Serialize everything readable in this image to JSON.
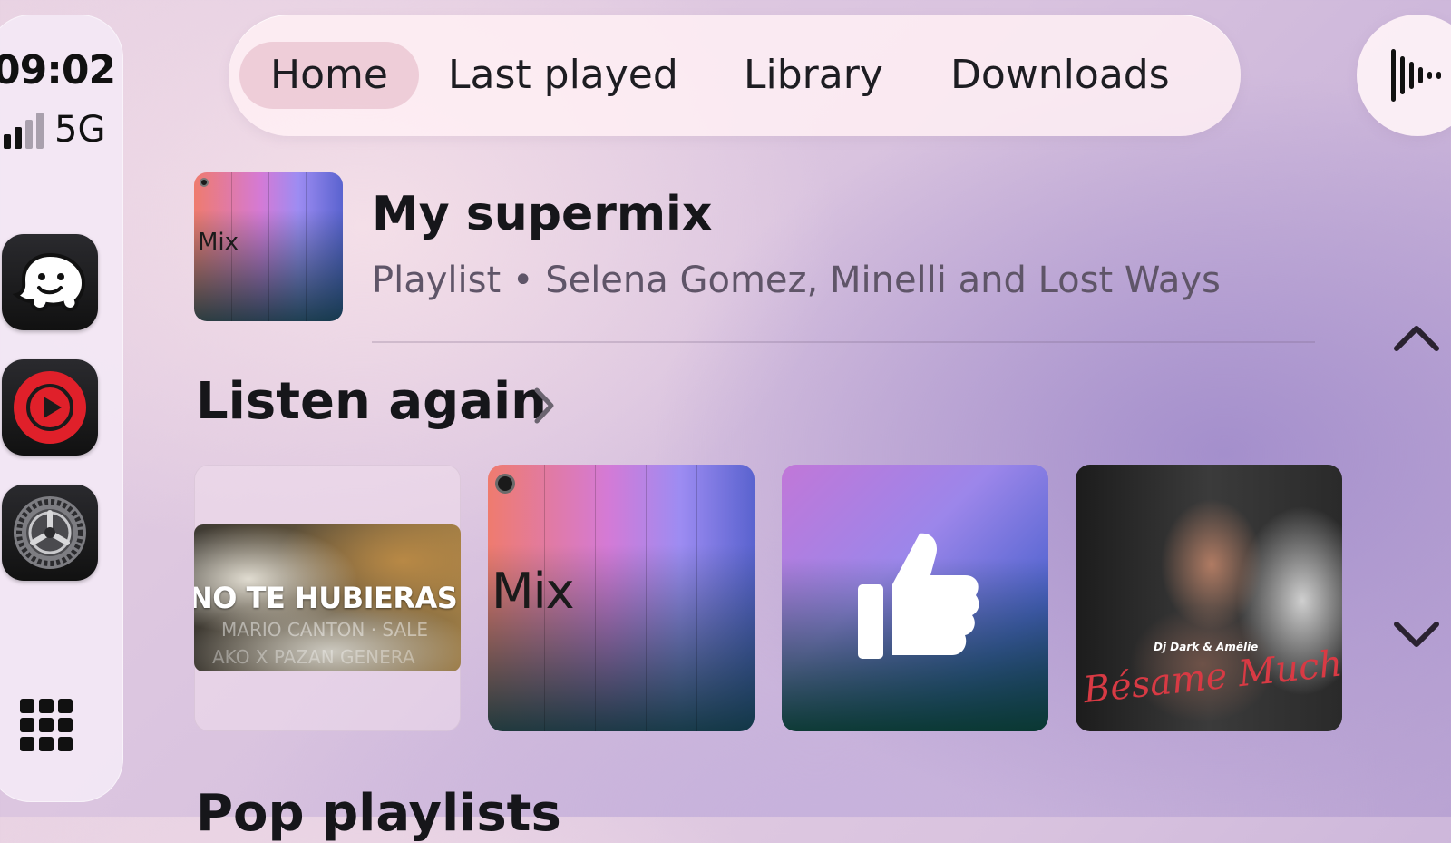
{
  "status": {
    "time": "09:02",
    "network": "5G",
    "signal_bars": 2
  },
  "dock": {
    "apps": [
      {
        "name": "Waze",
        "icon": "waze-icon"
      },
      {
        "name": "YouTube Music",
        "icon": "youtube-music-icon"
      },
      {
        "name": "Settings",
        "icon": "gear-icon"
      }
    ],
    "app_grid_icon": "app-grid-icon"
  },
  "tabs": [
    {
      "label": "Home",
      "active": true
    },
    {
      "label": "Last played",
      "active": false
    },
    {
      "label": "Library",
      "active": false
    },
    {
      "label": "Downloads",
      "active": false
    }
  ],
  "voice_icon": "voice-waveform-icon",
  "featured": {
    "thumb_label": "Mix",
    "title": "My supermix",
    "subtitle": "Playlist • Selena Gomez, Minelli and Lost Ways"
  },
  "scroll": {
    "up_icon": "chevron-up-icon",
    "down_icon": "chevron-down-icon"
  },
  "listen_again": {
    "heading": "Listen again",
    "cards": [
      {
        "type": "video-thumbnail",
        "text": "NO TE HUBIERAS I",
        "subtext": "MARIO CANTON · SALE",
        "subtext2": "AKO X PAZAN GENERA"
      },
      {
        "type": "mix",
        "label": "Mix"
      },
      {
        "type": "liked",
        "icon": "thumbs-up-icon"
      },
      {
        "type": "album",
        "artist": "Dj Dark & Amëlie",
        "title": "Bésame Mucho"
      }
    ]
  },
  "next_section": {
    "heading": "Pop playlists"
  },
  "colors": {
    "accent_tab": "#e2b4c2",
    "ytm_red": "#e0202a",
    "text_primary": "#16161a",
    "text_secondary": "#5f5568"
  }
}
